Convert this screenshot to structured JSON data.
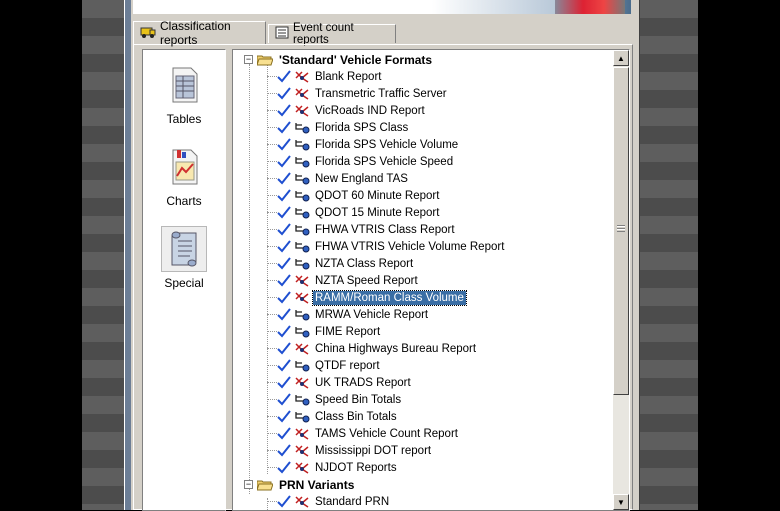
{
  "tabs": [
    {
      "label": "Classification reports",
      "icon": "vehicle-icon",
      "active": true
    },
    {
      "label": "Event count reports",
      "icon": "counter-icon",
      "active": false
    }
  ],
  "sidebar": {
    "items": [
      {
        "label": "Tables",
        "icon": "table-document-icon"
      },
      {
        "label": "Charts",
        "icon": "chart-document-icon"
      },
      {
        "label": "Special",
        "icon": "scroll-icon",
        "active": true
      }
    ]
  },
  "tree": {
    "groups": [
      {
        "label": "'Standard' Vehicle Formats",
        "expanded": true,
        "items": [
          {
            "label": "Blank Report",
            "icon": "red-split-icon"
          },
          {
            "label": "Transmetric Traffic Server",
            "icon": "red-split-icon"
          },
          {
            "label": "VicRoads IND Report",
            "icon": "red-split-icon"
          },
          {
            "label": "Florida SPS Class",
            "icon": "blue-branch-icon"
          },
          {
            "label": "Florida SPS Vehicle Volume",
            "icon": "blue-branch-icon"
          },
          {
            "label": "Florida SPS Vehicle Speed",
            "icon": "blue-branch-icon"
          },
          {
            "label": "New England TAS",
            "icon": "blue-branch-icon"
          },
          {
            "label": "QDOT 60 Minute Report",
            "icon": "blue-branch-icon"
          },
          {
            "label": "QDOT 15 Minute Report",
            "icon": "blue-branch-icon"
          },
          {
            "label": "FHWA VTRIS Class Report",
            "icon": "blue-branch-icon"
          },
          {
            "label": "FHWA VTRIS Vehicle Volume Report",
            "icon": "blue-branch-icon"
          },
          {
            "label": "NZTA Class Report",
            "icon": "blue-branch-icon"
          },
          {
            "label": "NZTA Speed Report",
            "icon": "red-split-icon"
          },
          {
            "label": "RAMM/Roman Class Volume",
            "icon": "red-split-icon",
            "selected": true
          },
          {
            "label": "MRWA Vehicle Report",
            "icon": "blue-branch-icon"
          },
          {
            "label": "FIME Report",
            "icon": "blue-branch-icon"
          },
          {
            "label": "China Highways Bureau Report",
            "icon": "red-split-icon"
          },
          {
            "label": "QTDF report",
            "icon": "blue-branch-icon"
          },
          {
            "label": "UK TRADS Report",
            "icon": "red-split-icon"
          },
          {
            "label": "Speed Bin Totals",
            "icon": "blue-branch-icon"
          },
          {
            "label": "Class Bin Totals",
            "icon": "blue-branch-icon"
          },
          {
            "label": "TAMS Vehicle Count Report",
            "icon": "red-split-icon"
          },
          {
            "label": "Mississippi DOT report",
            "icon": "red-split-icon"
          },
          {
            "label": "NJDOT Reports",
            "icon": "red-split-icon"
          }
        ]
      },
      {
        "label": "PRN Variants",
        "expanded": true,
        "items": [
          {
            "label": "Standard PRN",
            "icon": "red-split-icon"
          }
        ]
      }
    ]
  },
  "colors": {
    "selection": "#3a6ea5",
    "window_face": "#d4d0c8",
    "check": "#1f4fd0"
  }
}
